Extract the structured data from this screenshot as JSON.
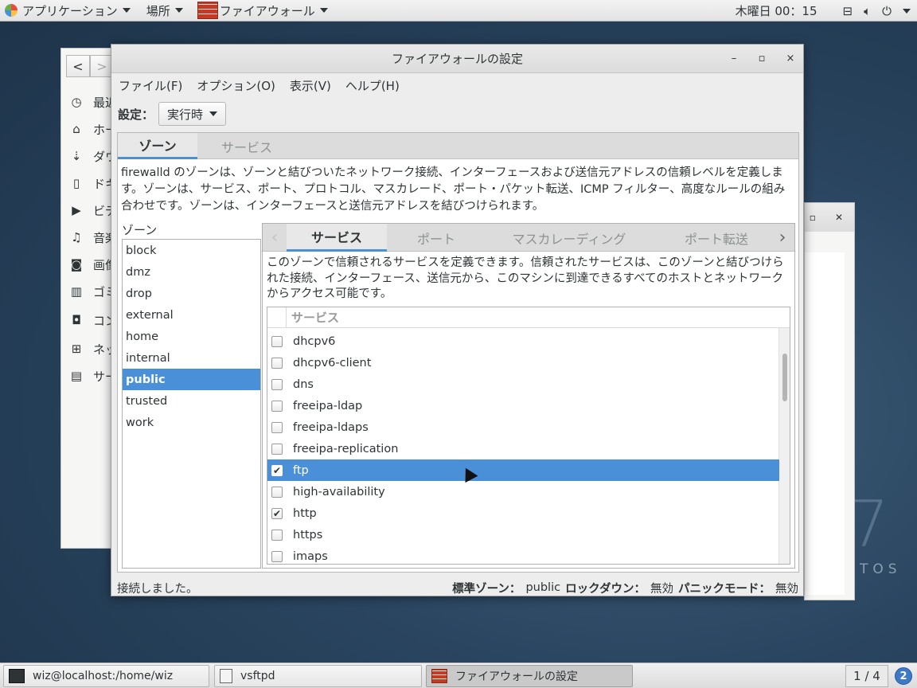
{
  "top_panel": {
    "applications": "アプリケーション",
    "places": "場所",
    "active_app": "ファイアウォール",
    "clock": "木曜日 00：15"
  },
  "file_manager_bg": {
    "items": [
      "最近",
      "ホー",
      "ダウ",
      "ドキ",
      "ビデ",
      "音楽",
      "画像",
      "ゴミ",
      "コン",
      "ネッ",
      "サー"
    ]
  },
  "desktop": {
    "centos_text": "TOS",
    "centos_seven": "7"
  },
  "window": {
    "title": "ファイアウォールの設定",
    "minimize": "–",
    "maximize": "▫",
    "close": "×"
  },
  "menubar": {
    "file": "ファイル(F)",
    "options": "オプション(O)",
    "view": "表示(V)",
    "help": "ヘルプ(H)"
  },
  "config": {
    "label": "設定：",
    "value": "実行時"
  },
  "top_tabs": {
    "zones": "ゾーン",
    "services": "サービス"
  },
  "zone_description": "firewalld のゾーンは、ゾーンと結びついたネットワーク接続、インターフェースおよび送信元アドレスの信頼レベルを定義します。ゾーンは、サービス、ポート、プロトコル、マスカレード、ポート・パケット転送、ICMP フィルター、高度なルールの組み合わせです。ゾーンは、インターフェースと送信元アドレスを結びつけられます。",
  "zones": {
    "title": "ゾーン",
    "items": [
      "block",
      "dmz",
      "drop",
      "external",
      "home",
      "internal",
      "public",
      "trusted",
      "work"
    ],
    "selected": "public"
  },
  "sub_tabs": {
    "services": "サービス",
    "ports": "ポート",
    "masquerading": "マスカレーディング",
    "port_forwarding": "ポート転送"
  },
  "services_description": "このゾーンで信頼されるサービスを定義できます。信頼されたサービスは、このゾーンと結びつけられた接続、インターフェース、送信元から、このマシンに到達できるすべてのホストとネットワークからアクセス可能です。",
  "services_table": {
    "header": "サービス",
    "rows": [
      {
        "name": "dhcpv6",
        "checked": false
      },
      {
        "name": "dhcpv6-client",
        "checked": false
      },
      {
        "name": "dns",
        "checked": false
      },
      {
        "name": "freeipa-ldap",
        "checked": false
      },
      {
        "name": "freeipa-ldaps",
        "checked": false
      },
      {
        "name": "freeipa-replication",
        "checked": false
      },
      {
        "name": "ftp",
        "checked": true,
        "selected": true
      },
      {
        "name": "high-availability",
        "checked": false
      },
      {
        "name": "http",
        "checked": true
      },
      {
        "name": "https",
        "checked": false
      },
      {
        "name": "imaps",
        "checked": false
      }
    ]
  },
  "status": {
    "message": "接続しました。",
    "default_zone_label": "標準ゾーン：",
    "default_zone": "public",
    "lockdown_label": "ロックダウン：",
    "lockdown": "無効",
    "panic_label": "パニックモード：",
    "panic": "無効"
  },
  "taskbar": {
    "terminal": "wiz@localhost:/home/wiz",
    "editor": "vsftpd",
    "firewall": "ファイアウォールの設定",
    "workspace": "1 / 4",
    "notifications": "2"
  },
  "colors": {
    "accent": "#4a90d9"
  }
}
